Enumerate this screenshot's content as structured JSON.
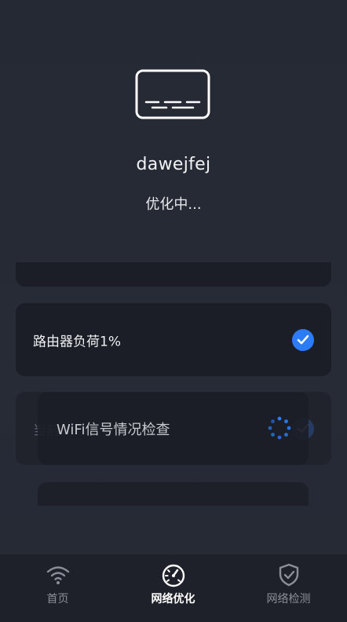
{
  "device": {
    "icon": "router-device-icon",
    "name": "dawejfej",
    "status": "优化中..."
  },
  "checks": [
    {
      "label": "路由器负荷1%",
      "state": "done",
      "icon": "check-circle-icon"
    },
    {
      "label": "当前",
      "state": "done",
      "icon": "check-circle-icon"
    }
  ],
  "current_check": {
    "label": "WiFi信号情况检查",
    "state": "loading",
    "icon": "loading-spinner-icon"
  },
  "tabs": [
    {
      "label": "首页",
      "icon": "wifi-icon",
      "active": false
    },
    {
      "label": "网络优化",
      "icon": "speedometer-icon",
      "active": true
    },
    {
      "label": "网络检测",
      "icon": "shield-check-icon",
      "active": false
    }
  ],
  "colors": {
    "background": "#272b36",
    "card": "#1b1e26",
    "accent": "#2b7cf6",
    "tabbar": "#1e2129"
  }
}
